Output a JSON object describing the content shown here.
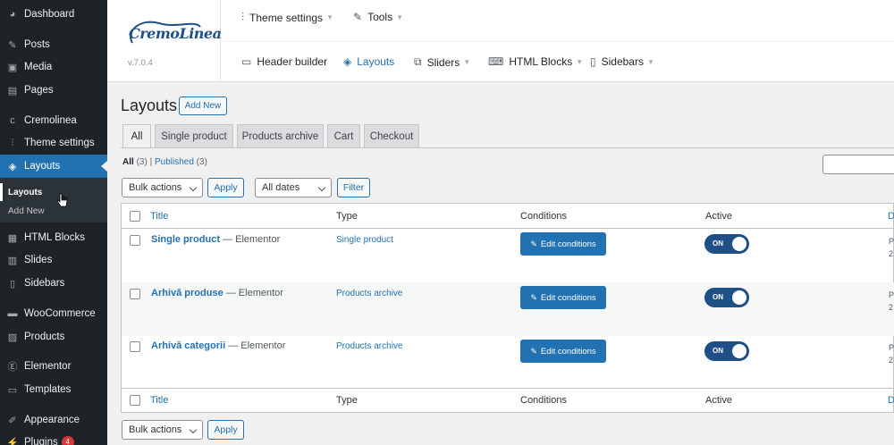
{
  "sidebar": {
    "items": [
      {
        "label": "Dashboard",
        "icon": "dashboard-icon",
        "glyph": "◕"
      },
      {
        "label": "Posts",
        "icon": "pin-icon",
        "glyph": "✎"
      },
      {
        "label": "Media",
        "icon": "media-icon",
        "glyph": "▣"
      },
      {
        "label": "Pages",
        "icon": "pages-icon",
        "glyph": "▤"
      },
      {
        "label": "Cremolinea",
        "icon": "cremolinea-icon",
        "glyph": "ᴄ"
      },
      {
        "label": "Theme settings",
        "icon": "sliders-icon",
        "glyph": "⫶"
      },
      {
        "label": "Layouts",
        "icon": "layers-icon",
        "glyph": "◈"
      },
      {
        "label": "HTML Blocks",
        "icon": "html-blocks-icon",
        "glyph": "▦"
      },
      {
        "label": "Slides",
        "icon": "slides-icon",
        "glyph": "▥"
      },
      {
        "label": "Sidebars",
        "icon": "sidebars-icon",
        "glyph": "▯"
      },
      {
        "label": "WooCommerce",
        "icon": "woocommerce-icon",
        "glyph": "▬"
      },
      {
        "label": "Products",
        "icon": "products-icon",
        "glyph": "▨"
      },
      {
        "label": "Elementor",
        "icon": "elementor-icon",
        "glyph": "Ⓔ"
      },
      {
        "label": "Templates",
        "icon": "folder-icon",
        "glyph": "▭"
      },
      {
        "label": "Appearance",
        "icon": "brush-icon",
        "glyph": "✐"
      },
      {
        "label": "Plugins",
        "icon": "plugin-icon",
        "glyph": "⚡",
        "badge": "4"
      }
    ],
    "submenu": {
      "current": "Layouts",
      "add_new": "Add New"
    }
  },
  "header": {
    "logo_text": "CremoLinea",
    "version": "v.7.0.4",
    "nav_top": [
      {
        "label": "Theme settings",
        "icon": "sliders-icon",
        "glyph": "⫶"
      },
      {
        "label": "Tools",
        "icon": "wrench-icon",
        "glyph": "🔧"
      }
    ],
    "nav_bottom": [
      {
        "label": "Header builder",
        "icon": "header-icon",
        "glyph": "▭"
      },
      {
        "label": "Layouts",
        "icon": "layers-icon",
        "glyph": "◈"
      },
      {
        "label": "Sliders",
        "icon": "sliders-stack-icon",
        "glyph": "⧉"
      },
      {
        "label": "HTML Blocks",
        "icon": "code-block-icon",
        "glyph": "⌨"
      },
      {
        "label": "Sidebars",
        "icon": "sidebar-panel-icon",
        "glyph": "▯"
      }
    ]
  },
  "page": {
    "title": "Layouts",
    "add_new": "Add New",
    "tabs": [
      "All",
      "Single product",
      "Products archive",
      "Cart",
      "Checkout"
    ],
    "views": {
      "all": "All",
      "all_count": "(3)",
      "sep": "|",
      "published": "Published",
      "published_count": "(3)"
    },
    "bulk_actions": "Bulk actions",
    "apply": "Apply",
    "all_dates": "All dates",
    "filter": "Filter"
  },
  "table": {
    "columns": [
      "Title",
      "Type",
      "Conditions",
      "Active",
      "D"
    ],
    "rows": [
      {
        "title": "Single product",
        "suffix": " — Elementor",
        "type": "Single product",
        "conditions": "Edit conditions",
        "active": "ON",
        "date_line1": "P",
        "date_line2": "2"
      },
      {
        "title": "Arhivă produse",
        "suffix": " — Elementor",
        "type": "Products archive",
        "conditions": "Edit conditions",
        "active": "ON",
        "date_line1": "P",
        "date_line2": "2"
      },
      {
        "title": "Arhivă categorii",
        "suffix": " — Elementor",
        "type": "Products archive",
        "conditions": "Edit conditions",
        "active": "ON",
        "date_line1": "P",
        "date_line2": "2"
      }
    ]
  },
  "colors": {
    "accent": "#2271b1",
    "sidebar_bg": "#1d2327",
    "toggle_on": "#1e4f86"
  }
}
